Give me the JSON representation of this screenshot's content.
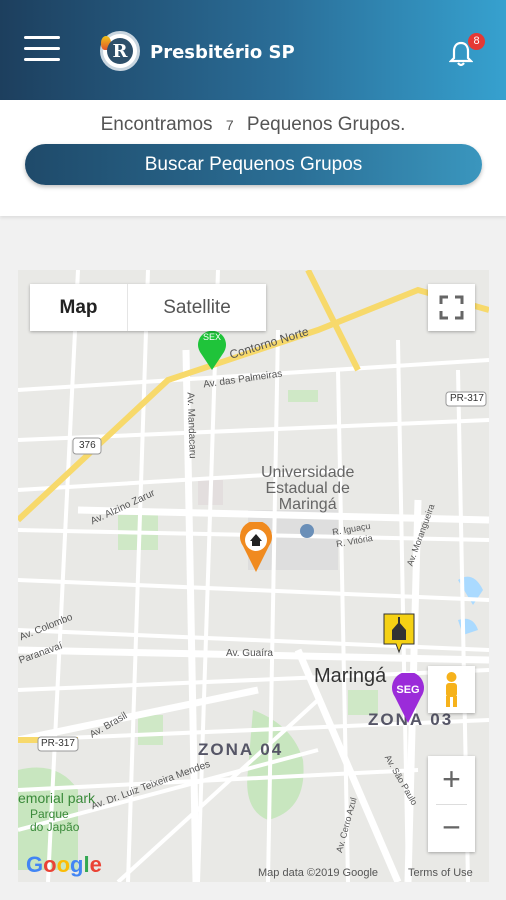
{
  "header": {
    "title": "Presbitério SP",
    "logo_letter": "R",
    "notification_count": "8"
  },
  "results": {
    "prefix": "Encontramos",
    "count": "7",
    "suffix": "Pequenos Grupos.",
    "search_button": "Buscar Pequenos Grupos"
  },
  "map": {
    "type_map": "Map",
    "type_satellite": "Satellite",
    "city": "Maringá",
    "labels": {
      "university": [
        "Universidade",
        "Estadual de",
        "Maringá"
      ],
      "contorno": "Contorno Norte",
      "palmeiras": "Av. das Palmeiras",
      "mandacaru": "Av. Mandacaru",
      "alzino": "Av. Alzino Zarur",
      "colombo": "Av. Colombo",
      "paranavai": "Paranavaí",
      "guaira": "Av. Guaíra",
      "brasil": "Av. Brasil",
      "luiz": "Av. Dr. Luiz Teixeira Mendes",
      "memorial": "emorial park",
      "parque": [
        "Parque",
        "do Japão"
      ],
      "zona04": "ZONA 04",
      "zona03": "ZONA 03",
      "route376": "376",
      "pr317a": "PR-317",
      "pr317b": "PR-317",
      "iguacu": "R. Iguaçu",
      "vitoria": "R. Vitória",
      "cerro": "Av. Cerro Azul",
      "saopaulo": "Av. São Paulo",
      "morangueira": "Av. Morangueira"
    },
    "markers": {
      "sex": "SEX",
      "seg": "SEG"
    },
    "google": "Google",
    "attribution": "Map data ©2019 Google",
    "terms": "Terms of Use",
    "zoom_in": "+",
    "zoom_out": "−"
  },
  "colors": {
    "marker_sex": "#1fc43a",
    "marker_seg": "#9b2bd9",
    "marker_home": "#f08a1f",
    "marker_church": "#f5d114"
  }
}
